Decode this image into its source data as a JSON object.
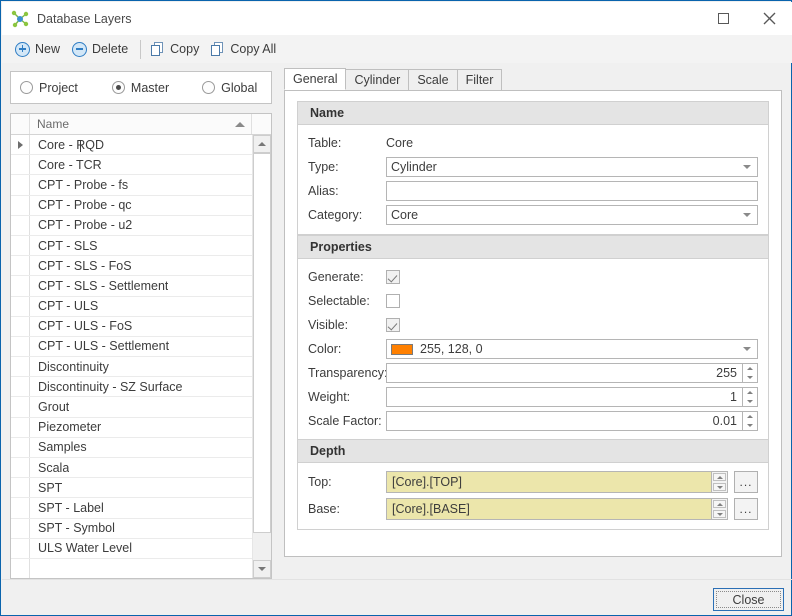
{
  "window": {
    "title": "Database Layers",
    "app_icon": "network-nodes-icon",
    "maximize_label": "",
    "close_label": ""
  },
  "toolbar": {
    "items": [
      {
        "label": "New",
        "icon": "plus-circle-icon"
      },
      {
        "label": "Delete",
        "icon": "minus-circle-icon"
      },
      {
        "label": "Copy",
        "icon": "copy-icon"
      },
      {
        "label": "Copy All",
        "icon": "copy-all-icon"
      }
    ]
  },
  "scope": {
    "options": [
      {
        "label": "Project",
        "selected": false
      },
      {
        "label": "Master",
        "selected": true
      },
      {
        "label": "Global",
        "selected": false
      }
    ]
  },
  "grid": {
    "column_header": "Name",
    "sort_direction": "ascending",
    "rows": [
      "Core - RQD",
      "Core - TCR",
      "CPT - Probe - fs",
      "CPT - Probe - qc",
      "CPT - Probe - u2",
      "CPT - SLS",
      "CPT - SLS - FoS",
      "CPT - SLS - Settlement",
      "CPT - ULS",
      "CPT - ULS - FoS",
      "CPT - ULS - Settlement",
      "Discontinuity",
      "Discontinuity - SZ Surface",
      "Grout",
      "Piezometer",
      "Samples",
      "Scala",
      "SPT",
      "SPT - Label",
      "SPT - Symbol",
      "ULS Water Level",
      ""
    ],
    "selected_row": "Core - RQD"
  },
  "tabs": [
    {
      "label": "General",
      "active": true
    },
    {
      "label": "Cylinder",
      "active": false
    },
    {
      "label": "Scale",
      "active": false
    },
    {
      "label": "Filter",
      "active": false
    }
  ],
  "general": {
    "name_group": {
      "title": "Name",
      "table_label": "Table:",
      "table_value": "Core",
      "type_label": "Type:",
      "type_value": "Cylinder",
      "alias_label": "Alias:",
      "alias_value": "",
      "category_label": "Category:",
      "category_value": "Core"
    },
    "properties_group": {
      "title": "Properties",
      "generate_label": "Generate:",
      "generate_checked": true,
      "selectable_label": "Selectable:",
      "selectable_checked": false,
      "visible_label": "Visible:",
      "visible_checked": true,
      "color_label": "Color:",
      "color_value": "255, 128, 0",
      "color_hex": "#ff8000",
      "transparency_label": "Transparency:",
      "transparency_value": "255",
      "weight_label": "Weight:",
      "weight_value": "1",
      "scale_factor_label": "Scale Factor:",
      "scale_factor_value": "0.01"
    },
    "depth_group": {
      "title": "Depth",
      "top_label": "Top:",
      "top_value": "[Core].[TOP]",
      "base_label": "Base:",
      "base_value": "[Core].[BASE]",
      "browse_label": "..."
    }
  },
  "footer": {
    "close_label": "Close"
  }
}
